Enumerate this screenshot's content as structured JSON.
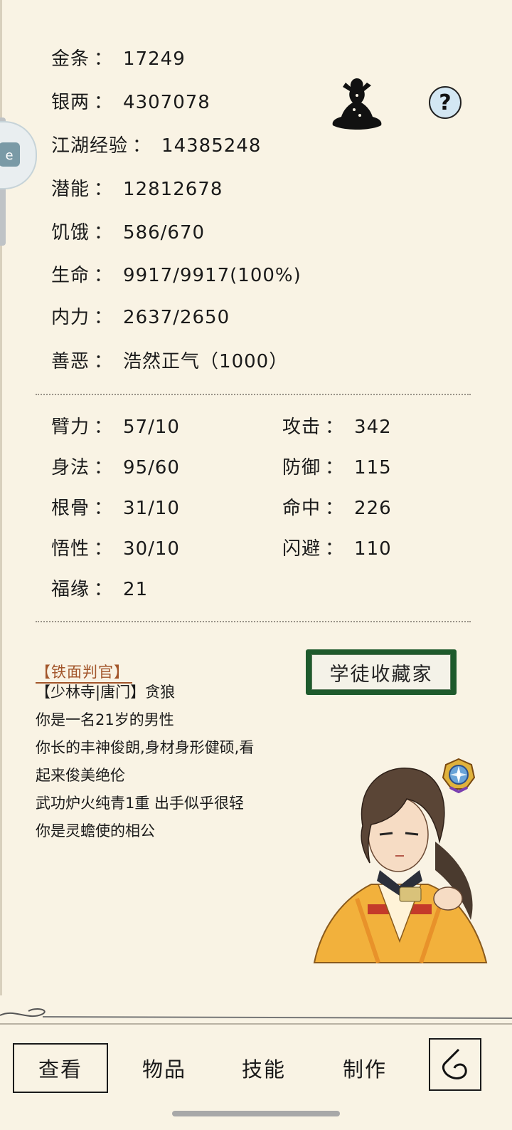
{
  "stats_top": [
    {
      "label": "金条",
      "value": "17249"
    },
    {
      "label": "银两",
      "value": "4307078"
    },
    {
      "label": "江湖经验",
      "value": "14385248"
    },
    {
      "label": "潜能",
      "value": "12812678"
    },
    {
      "label": "饥饿",
      "value": "586/670"
    },
    {
      "label": "生命",
      "value": "9917/9917(100%)"
    },
    {
      "label": "内力",
      "value": "2637/2650"
    },
    {
      "label": "善恶",
      "value": "浩然正气（1000）"
    }
  ],
  "attributes_left": [
    {
      "label": "臂力",
      "value": "57/10"
    },
    {
      "label": "身法",
      "value": "95/60"
    },
    {
      "label": "根骨",
      "value": "31/10"
    },
    {
      "label": "悟性",
      "value": "30/10"
    },
    {
      "label": "福缘",
      "value": "21"
    }
  ],
  "attributes_right": [
    {
      "label": "攻击",
      "value": "342"
    },
    {
      "label": "防御",
      "value": "115"
    },
    {
      "label": "命中",
      "value": "226"
    },
    {
      "label": "闪避",
      "value": "110"
    }
  ],
  "separator": "：",
  "title_tag": "【铁面判官】",
  "bio_lines": [
    "【少林寺|唐门】贪狼",
    "你是一名21岁的男性",
    "你长的丰神俊朗,身材身形健硕,看",
    "起来俊美绝伦",
    "武功炉火纯青1重 出手似乎很轻",
    "你是灵蟾使的相公"
  ],
  "plaque_text": "学徒收藏家",
  "help_glyph": "?",
  "nav": {
    "view_label": "查看",
    "items_label": "物品",
    "skills_label": "技能",
    "craft_label": "制作"
  },
  "icons": {
    "help": "help-icon",
    "meditation": "meditation-silhouette-icon",
    "back": "back-icon",
    "badge": "compass-badge-icon"
  },
  "colors": {
    "background": "#f9f3e4",
    "title_tag": "#a2552a",
    "plaque": "#1e5a2c"
  }
}
